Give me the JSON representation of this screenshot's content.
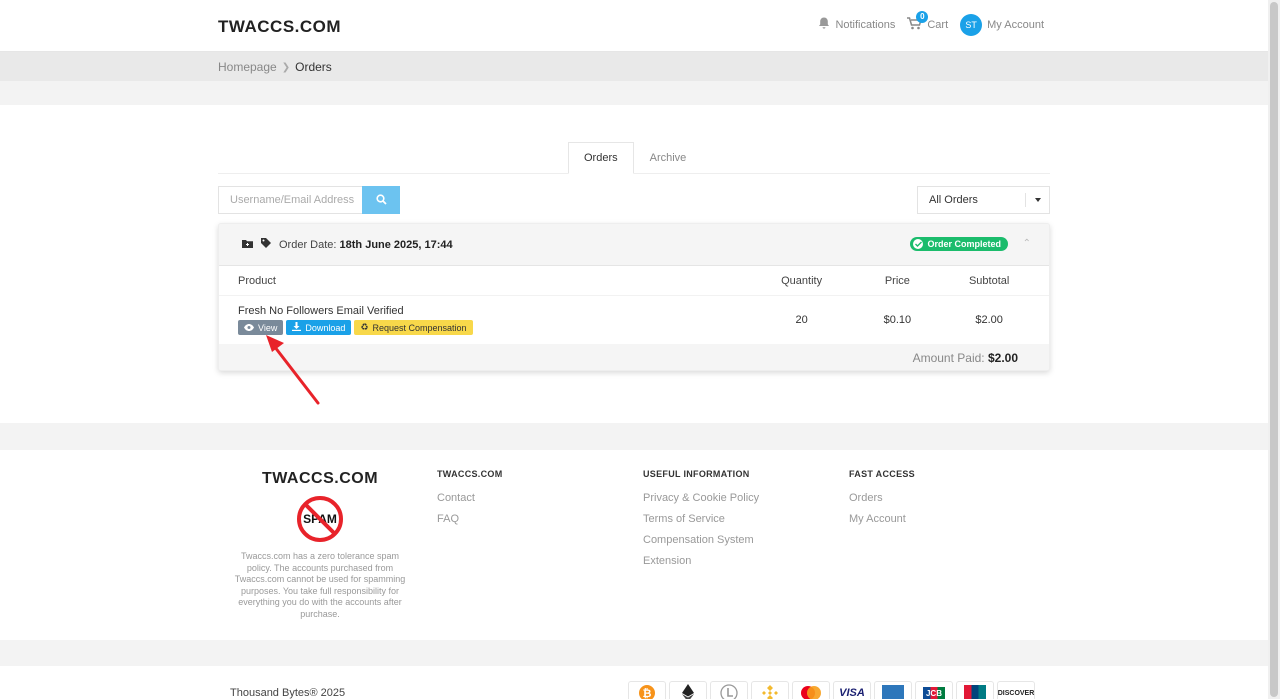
{
  "header": {
    "logo": "TWACCS.COM",
    "notifications_label": "Notifications",
    "cart_label": "Cart",
    "cart_count": "0",
    "account_initials": "ST",
    "account_label": "My Account"
  },
  "breadcrumb": {
    "home": "Homepage",
    "current": "Orders"
  },
  "tabs": [
    {
      "label": "Orders",
      "active": true
    },
    {
      "label": "Archive",
      "active": false
    }
  ],
  "search": {
    "placeholder": "Username/Email Address"
  },
  "filter": {
    "selected": "All Orders"
  },
  "order": {
    "date_label": "Order Date:",
    "date_value": "18th June 2025, 17:44",
    "status": "Order Completed",
    "columns": [
      "Product",
      "Quantity",
      "Price",
      "Subtotal"
    ],
    "items": [
      {
        "product": "Fresh No Followers Email Verified",
        "quantity": "20",
        "price": "$0.10",
        "subtotal": "$2.00",
        "buttons": {
          "view": "View",
          "download": "Download",
          "compensation": "Request Compensation"
        }
      }
    ],
    "amount_label": "Amount Paid:",
    "amount_value": "$2.00"
  },
  "footer": {
    "logo": "TWACCS.COM",
    "spam_text": "SPAM",
    "description": "Twaccs.com has a zero tolerance spam policy. The accounts purchased from Twaccs.com cannot be used for spamming purposes. You take full responsibility for everything you do with the accounts after purchase.",
    "col1": {
      "title": "TWACCS.COM",
      "links": [
        "Contact",
        "FAQ"
      ]
    },
    "col2": {
      "title": "USEFUL INFORMATION",
      "links": [
        "Privacy & Cookie Policy",
        "Terms of Service",
        "Compensation System",
        "Extension"
      ]
    },
    "col3": {
      "title": "FAST ACCESS",
      "links": [
        "Orders",
        "My Account"
      ]
    },
    "copyright": "Thousand Bytes® 2025"
  },
  "payments": [
    "bitcoin-icon",
    "ethereum-icon",
    "litecoin-icon",
    "binance-icon",
    "mastercard-icon",
    "visa-icon",
    "amex-icon",
    "jcb-icon",
    "unionpay-icon",
    "discover-icon"
  ],
  "payment_text": {
    "visa": "VISA",
    "jcb": "JCB",
    "discover": "DISCOVER"
  },
  "colors": {
    "accent": "#1aa1e8",
    "success": "#1bbc6c",
    "warning": "#f8d84a",
    "arrow": "#e8232a"
  }
}
